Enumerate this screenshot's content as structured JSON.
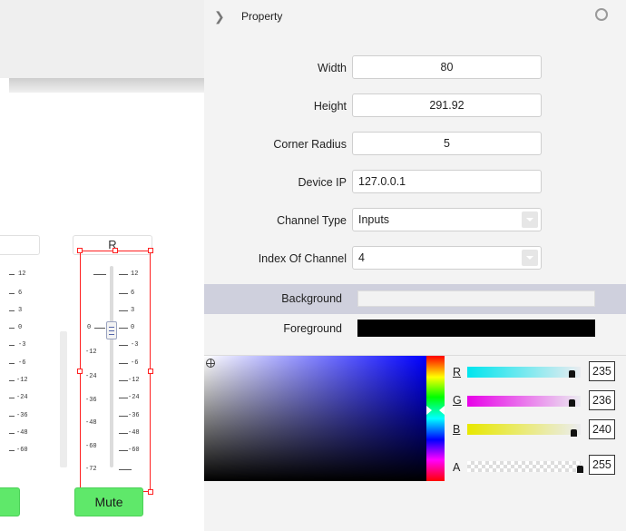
{
  "channel_strip": {
    "label_prev": "",
    "label_right": "R",
    "scale_left": [
      "12",
      "6",
      "3",
      "0",
      "-3",
      "-6",
      "-12",
      "-24",
      "-36",
      "-48",
      "-60"
    ],
    "scale_right": [
      "12",
      "6",
      "3",
      "0",
      "-3",
      "-6",
      "-12",
      "-24",
      "-36",
      "-48",
      "-60"
    ],
    "scale_inner": [
      "0",
      "-12",
      "-24",
      "-36",
      "-48",
      "-60",
      "-72"
    ],
    "mute_label": "Mute"
  },
  "property_panel": {
    "title": "Property",
    "fields": {
      "width": {
        "label": "Width",
        "value": "80"
      },
      "height": {
        "label": "Height",
        "value": "291.92"
      },
      "corner_radius": {
        "label": "Corner Radius",
        "value": "5"
      },
      "device_ip": {
        "label": "Device IP",
        "value": "127.0.0.1"
      },
      "channel_type": {
        "label": "Channel Type",
        "value": "Inputs"
      },
      "index_of_channel": {
        "label": "Index Of Channel",
        "value": "4"
      }
    },
    "background_label": "Background",
    "foreground_label": "Foreground",
    "background_color": "#f2f2f2",
    "foreground_color": "#000000"
  },
  "color_picker": {
    "channels": [
      {
        "name": "R",
        "value": "235",
        "color": "#ff2020"
      },
      {
        "name": "G",
        "value": "236",
        "color": "#ff20ff"
      },
      {
        "name": "B",
        "value": "240",
        "color": "#f0f020"
      },
      {
        "name": "A",
        "value": "255",
        "color": "#ffffff"
      }
    ],
    "selected_color": "#ebecf0"
  },
  "icons": {
    "expand": "chevron-right-icon",
    "status": "circle-icon",
    "picker": "crosshair-icon"
  }
}
